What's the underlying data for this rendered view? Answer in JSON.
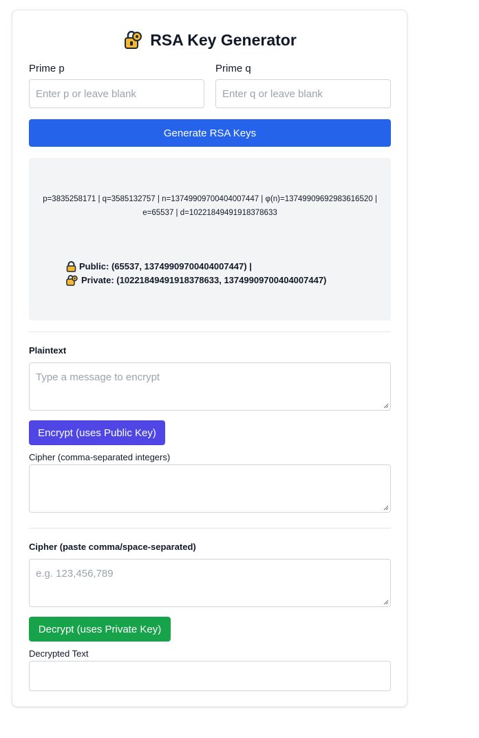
{
  "title": "RSA Key Generator",
  "icons": {
    "title": "lock-key-icon",
    "public": "lock-icon",
    "private": "lock-key-icon"
  },
  "colors": {
    "generate_button": "#2563eb",
    "encrypt_button": "#4f46e5",
    "decrypt_button": "#16a34a",
    "output_bg": "#f3f4f6",
    "icon_body": "#f5b82e"
  },
  "prime_p": {
    "label": "Prime p",
    "placeholder": "Enter p or leave blank",
    "value": ""
  },
  "prime_q": {
    "label": "Prime q",
    "placeholder": "Enter q or leave blank",
    "value": ""
  },
  "generate_button": "Generate RSA Keys",
  "output": {
    "params": "p=3835258171 | q=3585132757 | n=13749909700404007447 | φ(n)=13749909692983616520 | e=65537 | d=10221849491918378633",
    "public_key": "Public: (65537, 13749909700404007447) |",
    "private_key": "Private: (10221849491918378633, 13749909700404007447)"
  },
  "encrypt": {
    "plaintext_label": "Plaintext",
    "plaintext_placeholder": "Type a message to encrypt",
    "button": "Encrypt (uses Public Key)",
    "cipher_label": "Cipher (comma-separated integers)",
    "cipher_value": ""
  },
  "decrypt": {
    "cipher_label": "Cipher (paste comma/space-separated)",
    "cipher_placeholder": "e.g. 123,456,789",
    "button": "Decrypt (uses Private Key)",
    "result_label": "Decrypted Text",
    "result_value": ""
  }
}
